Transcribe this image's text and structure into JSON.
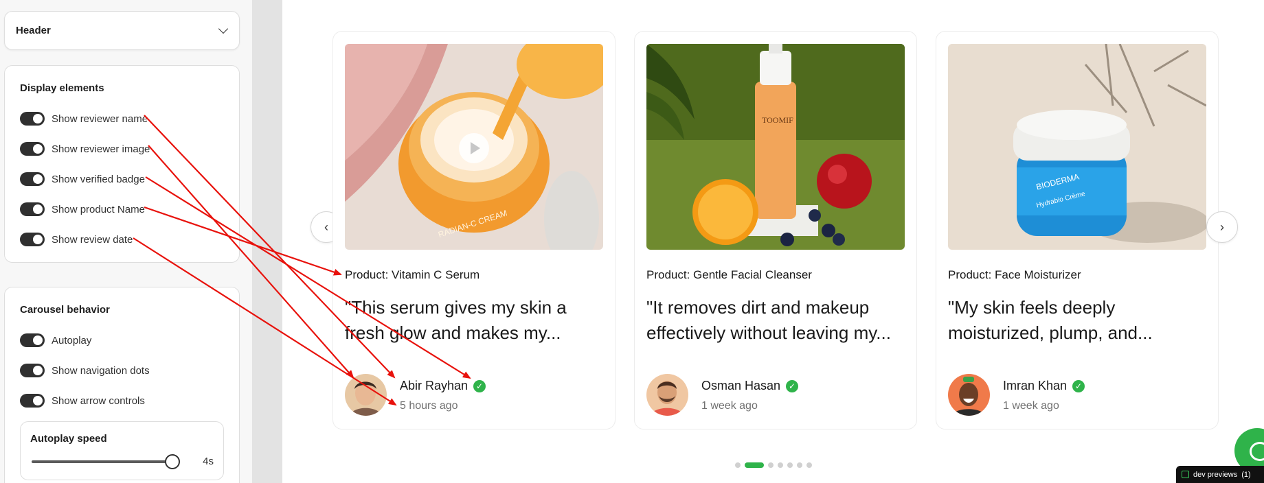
{
  "header_section": {
    "title": "Header"
  },
  "display_elements": {
    "title": "Display elements",
    "toggles": [
      {
        "label": "Show reviewer name",
        "on": true
      },
      {
        "label": "Show reviewer image",
        "on": true
      },
      {
        "label": "Show verified badge",
        "on": true
      },
      {
        "label": "Show product Name",
        "on": true
      },
      {
        "label": "Show review date",
        "on": true
      }
    ]
  },
  "carousel_behavior": {
    "title": "Carousel behavior",
    "toggles": [
      {
        "label": "Autoplay",
        "on": true
      },
      {
        "label": "Show navigation dots",
        "on": true
      },
      {
        "label": "Show arrow controls",
        "on": true
      }
    ],
    "autoplay_speed": {
      "label": "Autoplay speed",
      "value": "4s",
      "level": 1.0
    }
  },
  "reviews": [
    {
      "product": "Product: Vitamin C Serum",
      "quote_line1": "\"This serum gives my skin a",
      "quote_line2": "fresh glow and makes my...",
      "reviewer": "Abir Rayhan",
      "date": "5 hours ago"
    },
    {
      "product": "Product: Gentle Facial Cleanser",
      "quote_line1": "\"It removes dirt and makeup",
      "quote_line2": "effectively without leaving my...",
      "reviewer": "Osman Hasan",
      "date": "1 week ago"
    },
    {
      "product": "Product: Face Moisturizer",
      "quote_line1": "\"My skin feels deeply",
      "quote_line2": "moisturized, plump, and...",
      "reviewer": "Imran Khan",
      "date": "1 week ago"
    }
  ],
  "icons": {
    "prev": "‹",
    "next": "›",
    "verified": "✓"
  },
  "pagination": {
    "count": 7,
    "active": 1
  },
  "dev_badge": {
    "label": "dev previews",
    "count": "(1)"
  },
  "colors": {
    "accent_green": "#2fb34a",
    "annotation_red": "#e8120c",
    "toggle_on": "#303030"
  }
}
